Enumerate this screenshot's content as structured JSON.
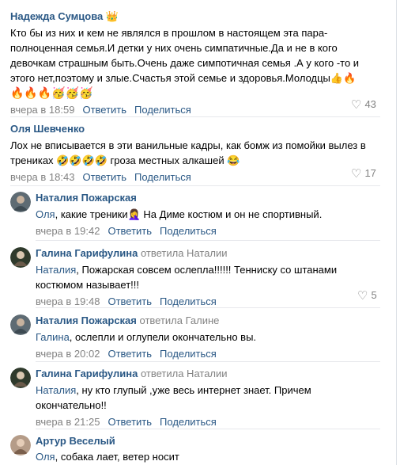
{
  "actions": {
    "reply": "Ответить",
    "share": "Поделиться"
  },
  "c1": {
    "author": "Надежда Сумцова",
    "badge": "👑",
    "lines": [
      "Кто бы из них и кем не являлся в прошлом в настоящем эта пара-",
      "полноценная семья.И детки у них очень симпатичные.Да и не в кого",
      "девочкам страшным быть.Очень даже симпотичная семья .А у кого -то и",
      "этого нет,поэтому и злые.Счастья этой семье и здоровья.Молодцы👍🔥",
      "🔥🔥🔥🥳🥳🥳"
    ],
    "time": "вчера в 18:59",
    "likes": "43"
  },
  "c2": {
    "author": "Оля Шевченко",
    "lines": [
      "Лох не вписывается в эти ванильные кадры, как бомж из помойки вылез в",
      "трениках 🤣🤣🤣🤣 гроза местных алкашей 😂"
    ],
    "time": "вчера в 18:43",
    "likes": "17"
  },
  "c3": {
    "author": "Наталия Пожарская",
    "mention": "Оля",
    "lines": [
      ", какие треники🤦‍♀️ На Диме костюм и он не спортивный."
    ],
    "time": "вчера в 19:42"
  },
  "c4": {
    "author": "Галина Гарифулина",
    "reply_to": "ответила Наталии",
    "mention": "Наталия",
    "lines": [
      ", Пожарская совсем ослепла!!!!!! Тенниску со штанами",
      "костюмом называет!!!"
    ],
    "time": "вчера в 19:48",
    "likes": "5"
  },
  "c5": {
    "author": "Наталия Пожарская",
    "reply_to": "ответила Галине",
    "mention": "Галина",
    "lines": [
      ", ослепли и оглупели окончательно вы."
    ],
    "time": "вчера в 20:02"
  },
  "c6": {
    "author": "Галина Гарифулина",
    "reply_to": "ответила Наталии",
    "mention": "Наталия",
    "lines": [
      ", ну кто глупый ,уже весь интернет знает. Причем",
      "окончательно!!"
    ],
    "time": "вчера в 21:25"
  },
  "c7": {
    "author": "Артур Веселый",
    "mention": "Оля",
    "lines": [
      ", собака лает, ветер носит"
    ]
  }
}
